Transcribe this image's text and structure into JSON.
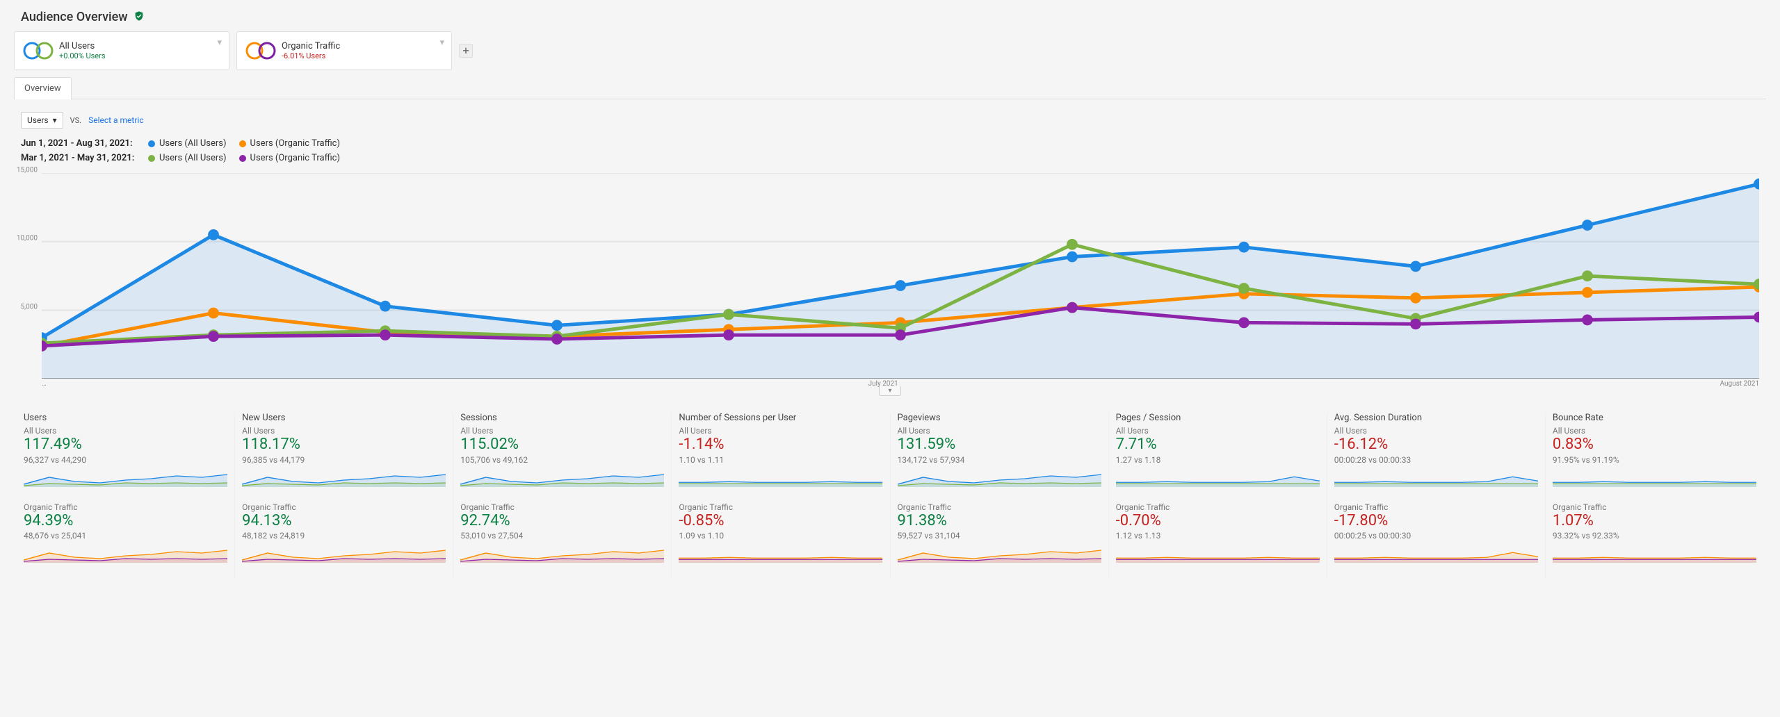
{
  "header": {
    "title": "Audience Overview"
  },
  "segments": {
    "items": [
      {
        "name": "All Users",
        "delta": "+0.00% Users",
        "delta_class": "delta-green",
        "ring_colors": [
          "#1e88e5",
          "#7cb342"
        ]
      },
      {
        "name": "Organic Traffic",
        "delta": "-6.01% Users",
        "delta_class": "delta-red",
        "ring_colors": [
          "#fb8c00",
          "#7b1fa2"
        ]
      }
    ],
    "add_label": "+"
  },
  "tabs": {
    "active": "Overview"
  },
  "metric_selector": {
    "selected": "Users",
    "vs": "VS.",
    "secondary": "Select a metric"
  },
  "legend": {
    "rows": [
      {
        "label": "Jun 1, 2021 - Aug 31, 2021:",
        "items": [
          {
            "color": "#1e88e5",
            "text": "Users (All Users)"
          },
          {
            "color": "#fb8c00",
            "text": "Users (Organic Traffic)"
          }
        ]
      },
      {
        "label": "Mar 1, 2021 - May 31, 2021:",
        "items": [
          {
            "color": "#7cb342",
            "text": "Users (All Users)"
          },
          {
            "color": "#8e24aa",
            "text": "Users (Organic Traffic)"
          }
        ]
      }
    ]
  },
  "chart_data": {
    "type": "line",
    "ylim": [
      0,
      15000
    ],
    "yticks": [
      5000,
      10000,
      15000
    ],
    "ytick_labels": [
      "5,000",
      "10,000",
      "15,000"
    ],
    "xtick_labels": [
      "…",
      "July 2021",
      "August 2021"
    ],
    "x_points": 11,
    "series": [
      {
        "name": "Users (All Users) — current",
        "color": "#1e88e5",
        "fill": "rgba(30,136,229,0.12)",
        "values": [
          3000,
          10500,
          5300,
          3900,
          4700,
          6800,
          8900,
          9600,
          8200,
          11200,
          14200
        ]
      },
      {
        "name": "Users (Organic Traffic) — current",
        "color": "#fb8c00",
        "values": [
          2400,
          4800,
          3400,
          3100,
          3600,
          4100,
          5200,
          6200,
          5900,
          6300,
          6700
        ]
      },
      {
        "name": "Users (All Users) — previous",
        "color": "#7cb342",
        "values": [
          2600,
          3200,
          3500,
          3100,
          4700,
          3700,
          9800,
          6600,
          4400,
          7500,
          6900
        ]
      },
      {
        "name": "Users (Organic Traffic) — previous",
        "color": "#8e24aa",
        "values": [
          2400,
          3100,
          3200,
          2900,
          3200,
          3200,
          5200,
          4100,
          4000,
          4300,
          4500
        ]
      }
    ]
  },
  "metrics": [
    {
      "title": "Users",
      "blocks": [
        {
          "seg": "All Users",
          "value": "117.49%",
          "cls": "green",
          "compare": "96,327 vs 44,290",
          "spark_a": "#1e88e5",
          "spark_b": "#7cb342"
        },
        {
          "seg": "Organic Traffic",
          "value": "94.39%",
          "cls": "green",
          "compare": "48,676 vs 25,041",
          "spark_a": "#fb8c00",
          "spark_b": "#8e24aa"
        }
      ]
    },
    {
      "title": "New Users",
      "blocks": [
        {
          "seg": "All Users",
          "value": "118.17%",
          "cls": "green",
          "compare": "96,385 vs 44,179",
          "spark_a": "#1e88e5",
          "spark_b": "#7cb342"
        },
        {
          "seg": "Organic Traffic",
          "value": "94.13%",
          "cls": "green",
          "compare": "48,182 vs 24,819",
          "spark_a": "#fb8c00",
          "spark_b": "#8e24aa"
        }
      ]
    },
    {
      "title": "Sessions",
      "blocks": [
        {
          "seg": "All Users",
          "value": "115.02%",
          "cls": "green",
          "compare": "105,706 vs 49,162",
          "spark_a": "#1e88e5",
          "spark_b": "#7cb342"
        },
        {
          "seg": "Organic Traffic",
          "value": "92.74%",
          "cls": "green",
          "compare": "53,010 vs 27,504",
          "spark_a": "#fb8c00",
          "spark_b": "#8e24aa"
        }
      ]
    },
    {
      "title": "Number of Sessions per User",
      "blocks": [
        {
          "seg": "All Users",
          "value": "-1.14%",
          "cls": "red",
          "compare": "1.10 vs 1.11",
          "spark_a": "#1e88e5",
          "spark_b": "#7cb342",
          "flat": true
        },
        {
          "seg": "Organic Traffic",
          "value": "-0.85%",
          "cls": "red",
          "compare": "1.09 vs 1.10",
          "spark_a": "#fb8c00",
          "spark_b": "#8e24aa",
          "flat": true
        }
      ]
    },
    {
      "title": "Pageviews",
      "blocks": [
        {
          "seg": "All Users",
          "value": "131.59%",
          "cls": "green",
          "compare": "134,172 vs 57,934",
          "spark_a": "#1e88e5",
          "spark_b": "#7cb342"
        },
        {
          "seg": "Organic Traffic",
          "value": "91.38%",
          "cls": "green",
          "compare": "59,527 vs 31,104",
          "spark_a": "#fb8c00",
          "spark_b": "#8e24aa"
        }
      ]
    },
    {
      "title": "Pages / Session",
      "blocks": [
        {
          "seg": "All Users",
          "value": "7.71%",
          "cls": "green",
          "compare": "1.27 vs 1.18",
          "spark_a": "#1e88e5",
          "spark_b": "#7cb342",
          "flat": true,
          "tail_up": true
        },
        {
          "seg": "Organic Traffic",
          "value": "-0.70%",
          "cls": "red",
          "compare": "1.12 vs 1.13",
          "spark_a": "#fb8c00",
          "spark_b": "#8e24aa",
          "flat": true
        }
      ]
    },
    {
      "title": "Avg. Session Duration",
      "blocks": [
        {
          "seg": "All Users",
          "value": "-16.12%",
          "cls": "red",
          "compare": "00:00:28 vs 00:00:33",
          "spark_a": "#1e88e5",
          "spark_b": "#7cb342",
          "flat": true,
          "tail_up": true
        },
        {
          "seg": "Organic Traffic",
          "value": "-17.80%",
          "cls": "red",
          "compare": "00:00:25 vs 00:00:30",
          "spark_a": "#fb8c00",
          "spark_b": "#8e24aa",
          "flat": true,
          "tail_up": true
        }
      ]
    },
    {
      "title": "Bounce Rate",
      "blocks": [
        {
          "seg": "All Users",
          "value": "0.83%",
          "cls": "red",
          "compare": "91.95% vs 91.19%",
          "spark_a": "#1e88e5",
          "spark_b": "#7cb342",
          "flat": true
        },
        {
          "seg": "Organic Traffic",
          "value": "1.07%",
          "cls": "red",
          "compare": "93.32% vs 92.33%",
          "spark_a": "#fb8c00",
          "spark_b": "#8e24aa",
          "flat": true
        }
      ]
    }
  ]
}
